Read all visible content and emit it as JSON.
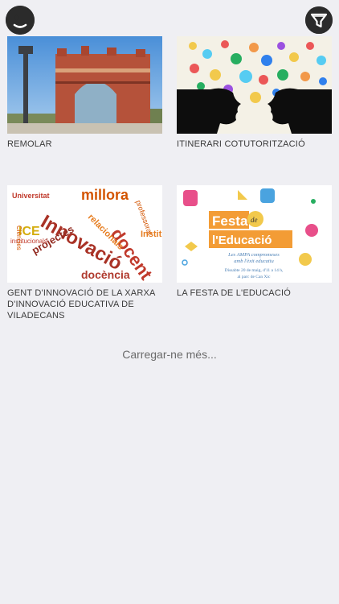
{
  "header": {
    "avatar_icon": "avatar-face-icon",
    "filter_icon": "filter-funnel-icon"
  },
  "cards": [
    {
      "title": "REMOLAR",
      "image": "arc-de-triomf-photo"
    },
    {
      "title": "ITINERARI COTUTORITZACIÓ",
      "image": "gears-heads-illustration"
    },
    {
      "title": "GENT D'INNOVACIÓ DE LA XARXA D'INNOVACIÓ EDUCATIVA DE VILADECANS",
      "image": "innovacio-word-cloud"
    },
    {
      "title": "LA FESTA DE L'EDUCACIÓ",
      "image": "festa-educacio-poster"
    }
  ],
  "wordcloud": {
    "words": [
      "Universitat",
      "millora",
      "docent",
      "Innovació",
      "relacionals",
      "professorat",
      "ICE",
      "projectes",
      "institucionals",
      "docència",
      "Ciències",
      "Institut"
    ]
  },
  "poster": {
    "line1": "Festa",
    "de": "de",
    "line2": "l'Educació",
    "sub1": "Les AMPA compromeses",
    "sub2": "amb l'èxit educatiu",
    "date": "Dissabte 20 de maig, d'11 a 14 h,",
    "place": "al parc de Can Xic"
  },
  "load_more": "Carregar-ne més..."
}
